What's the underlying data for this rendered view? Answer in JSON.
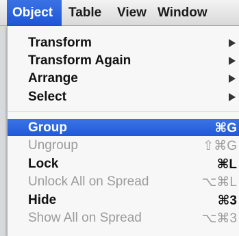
{
  "menubar": {
    "items": [
      "Object",
      "Table",
      "View",
      "Window"
    ]
  },
  "menu": {
    "items": [
      {
        "label": "Transform",
        "submenu": true
      },
      {
        "label": "Transform Again",
        "submenu": true
      },
      {
        "label": "Arrange",
        "submenu": true
      },
      {
        "label": "Select",
        "submenu": true
      },
      {
        "label": "Group",
        "shortcut": "⌘G",
        "selected": true
      },
      {
        "label": "Ungroup",
        "shortcut": "⇧⌘G",
        "disabled": true
      },
      {
        "label": "Lock",
        "shortcut": "⌘L"
      },
      {
        "label": "Unlock All on Spread",
        "shortcut": "⌥⌘L",
        "disabled": true
      },
      {
        "label": "Hide",
        "shortcut": "⌘3"
      },
      {
        "label": "Show All on Spread",
        "shortcut": "⌥⌘3",
        "disabled": true
      }
    ]
  },
  "colors": {
    "highlight": "#2b63dd",
    "disabled_text": "#9b9b9b"
  }
}
